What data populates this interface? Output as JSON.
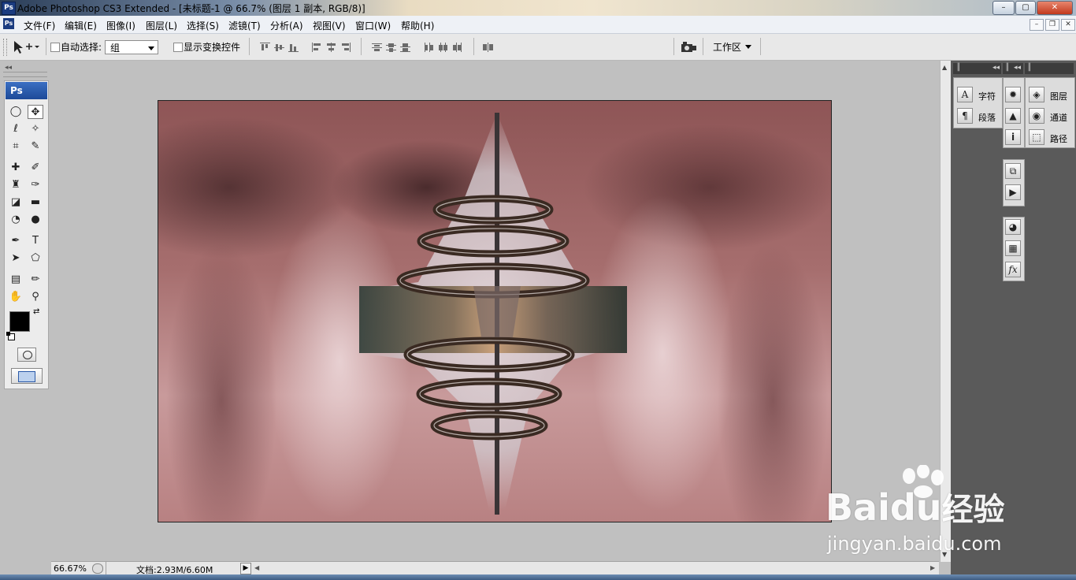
{
  "window": {
    "app_icon": "Ps",
    "title": "Adobe Photoshop CS3 Extended - [未标题-1 @ 66.7% (图层 1 副本, RGB/8)]",
    "buttons": {
      "minimize": "–",
      "maximize": "▢",
      "close": "✕"
    }
  },
  "menubar": {
    "doc_icon": "Ps",
    "items": [
      "文件(F)",
      "编辑(E)",
      "图像(I)",
      "图层(L)",
      "选择(S)",
      "滤镜(T)",
      "分析(A)",
      "视图(V)",
      "窗口(W)",
      "帮助(H)"
    ],
    "mdi_buttons": {
      "minimize": "–",
      "restore": "❐",
      "close": "✕"
    }
  },
  "options": {
    "auto_select_label": "自动选择:",
    "auto_select_value": "组",
    "show_transform_label": "显示变换控件",
    "workspace_label": "工作区"
  },
  "toolbox": {
    "logo": "Ps",
    "tools": [
      {
        "icon": "marquee-icon",
        "glyph": "◯"
      },
      {
        "icon": "move-icon",
        "glyph": "✥"
      },
      {
        "icon": "lasso-icon",
        "glyph": "ℓ"
      },
      {
        "icon": "magic-wand-icon",
        "glyph": "✧"
      },
      {
        "icon": "crop-icon",
        "glyph": "⌗"
      },
      {
        "icon": "slice-icon",
        "glyph": "✎"
      },
      {
        "icon": "healing-brush-icon",
        "glyph": "✚"
      },
      {
        "icon": "brush-icon",
        "glyph": "✐"
      },
      {
        "icon": "stamp-icon",
        "glyph": "♜"
      },
      {
        "icon": "history-brush-icon",
        "glyph": "✑"
      },
      {
        "icon": "eraser-icon",
        "glyph": "◪"
      },
      {
        "icon": "gradient-icon",
        "glyph": "▬"
      },
      {
        "icon": "blur-icon",
        "glyph": "◔"
      },
      {
        "icon": "dodge-icon",
        "glyph": "●"
      },
      {
        "icon": "pen-icon",
        "glyph": "✒"
      },
      {
        "icon": "type-icon",
        "glyph": "T"
      },
      {
        "icon": "path-selection-icon",
        "glyph": "➤"
      },
      {
        "icon": "shape-icon",
        "glyph": "⬠"
      },
      {
        "icon": "notes-icon",
        "glyph": "▤"
      },
      {
        "icon": "eyedropper-icon",
        "glyph": "✏"
      },
      {
        "icon": "hand-icon",
        "glyph": "✋"
      },
      {
        "icon": "zoom-icon",
        "glyph": "⚲"
      }
    ],
    "foreground_color": "#000000",
    "background_color": "#ffffff"
  },
  "status": {
    "zoom": "66.67%",
    "doc_info": "文档:2.93M/6.60M"
  },
  "panels": {
    "group1": [
      {
        "icon": "character-icon",
        "glyph": "A",
        "label": "字符"
      },
      {
        "icon": "paragraph-icon",
        "glyph": "¶",
        "label": "段落"
      }
    ],
    "group2": [
      {
        "icon": "navigator-icon",
        "glyph": "✹"
      },
      {
        "icon": "histogram-icon",
        "glyph": "▲"
      },
      {
        "icon": "info-icon",
        "glyph": "i"
      },
      {
        "icon": "history-icon",
        "glyph": "⧉"
      },
      {
        "icon": "actions-icon",
        "glyph": "▶"
      },
      {
        "icon": "color-icon",
        "glyph": "◕"
      },
      {
        "icon": "swatches-icon",
        "glyph": "▦"
      },
      {
        "icon": "styles-icon",
        "glyph": "fx"
      }
    ],
    "group3": [
      {
        "icon": "layers-icon",
        "glyph": "◈",
        "label": "图层"
      },
      {
        "icon": "channels-icon",
        "glyph": "◉",
        "label": "通道"
      },
      {
        "icon": "paths-icon",
        "glyph": "⬚",
        "label": "路径"
      }
    ]
  },
  "watermark": {
    "brand": "Bai",
    "brand2": "du",
    "product": "经验",
    "url": "jingyan.baidu.com"
  }
}
